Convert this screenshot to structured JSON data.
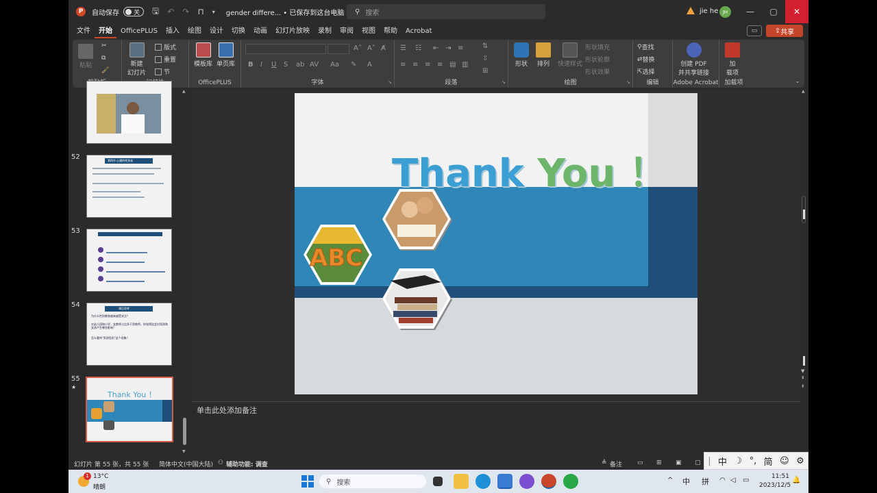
{
  "titlebar": {
    "autosave_label": "自动保存",
    "autosave_state": "关",
    "doc_title": "gender differe...  • 已保存到这台电脑 ⌄",
    "search_placeholder": "搜索",
    "user_name": "jie he",
    "user_initials": "JH"
  },
  "menu": {
    "tabs": [
      "文件",
      "开始",
      "OfficePLUS",
      "插入",
      "绘图",
      "设计",
      "切换",
      "动画",
      "幻灯片放映",
      "录制",
      "审阅",
      "视图",
      "帮助",
      "Acrobat"
    ],
    "active": "开始",
    "share_label": "共享"
  },
  "ribbon": {
    "groups": {
      "clipboard": "剪贴板",
      "slides": "幻灯片",
      "officeplus": "OfficePLUS",
      "font": "字体",
      "paragraph": "段落",
      "drawing": "绘图",
      "editing": "编辑",
      "acrobat": "Adobe Acrobat",
      "addins": "加载项"
    },
    "buttons": {
      "paste": "粘贴",
      "new_slide_1": "新建",
      "new_slide_2": "幻灯片",
      "layout": "版式",
      "reset": "重置",
      "section": "节",
      "template_lib": "模板库",
      "single_lib": "单页库",
      "shapes": "形状",
      "arrange": "排列",
      "quick_styles": "快速样式",
      "shape_fill": "形状填充",
      "shape_outline": "形状轮廓",
      "shape_effects": "形状效果",
      "find": "查找",
      "replace": "替换",
      "select": "选择",
      "create_pdf_1": "创建 PDF",
      "create_pdf_2": "并共享链接",
      "addin_1": "加",
      "addin_2": "载项"
    }
  },
  "slides_panel": {
    "numbers": [
      "52",
      "53",
      "54",
      "55"
    ],
    "thumb54_title": "课后思考",
    "thumb54_lines": [
      "为什么性别教育越来越受关注？",
      "在幼儿园和小学，女教师占比多于男教师。你觉得这会对男孩和女孩产生哪些影响？",
      "怎么看待\"男孩危机\"这个现象？"
    ],
    "thumb52_title": "第四节 心理的性别化",
    "thumb55_title": "Thank You ！",
    "thumb53_items": [
      "1",
      "2",
      "3",
      "4"
    ]
  },
  "slide": {
    "title": "Thank You ！",
    "abc_text": "ABC",
    "colors": {
      "title_blue": "#3b9fd4",
      "title_green": "#6db56a",
      "band_blue": "#2f86b8",
      "band_dark": "#1f4e79"
    }
  },
  "notes": {
    "placeholder": "单击此处添加备注"
  },
  "statusbar": {
    "slide_info": "幻灯片 第 55 张，共 55 张",
    "language": "简体中文(中国大陆)",
    "accessibility": "辅助功能: 调查",
    "notes_btn": "备注"
  },
  "ime": {
    "items": [
      "中",
      "☽",
      "°,",
      "简",
      "☺",
      "⚙"
    ]
  },
  "taskbar": {
    "weather_temp": "13°C",
    "weather_desc": "晴朗",
    "weather_badge": "1",
    "search_label": "搜索",
    "tray_ime_1": "中",
    "tray_ime_2": "拼",
    "time": "11:51",
    "date": "2023/12/5"
  }
}
